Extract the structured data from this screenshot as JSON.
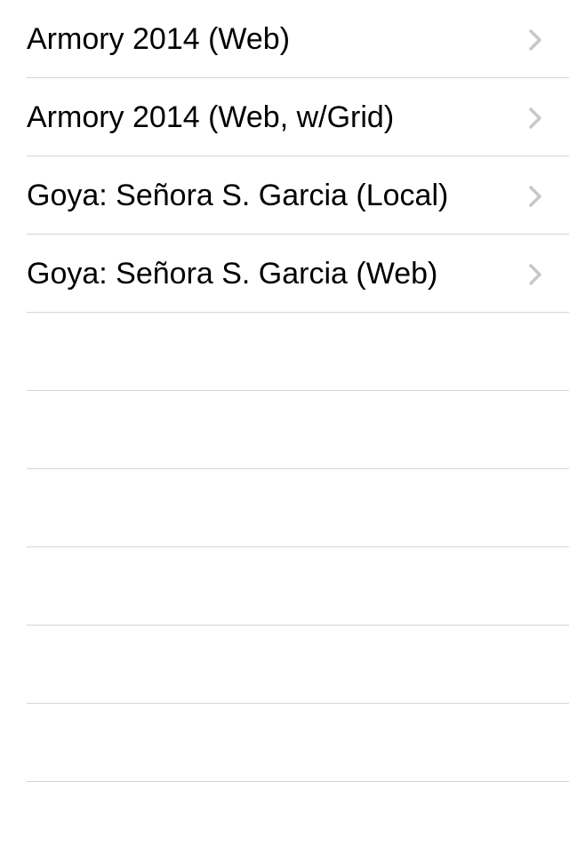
{
  "list": {
    "items": [
      {
        "label": "Armory 2014 (Web)",
        "accessory": "chevron-right-icon"
      },
      {
        "label": "Armory 2014 (Web, w/Grid)",
        "accessory": "chevron-right-icon"
      },
      {
        "label": "Goya: Señora S. Garcia (Local)",
        "accessory": "chevron-right-icon"
      },
      {
        "label": "Goya: Señora S. Garcia (Web)",
        "accessory": "chevron-right-icon"
      }
    ]
  },
  "colors": {
    "background": "#ffffff",
    "text": "#000000",
    "separator": "#d6d6da",
    "chevron": "#c7c7cc"
  }
}
